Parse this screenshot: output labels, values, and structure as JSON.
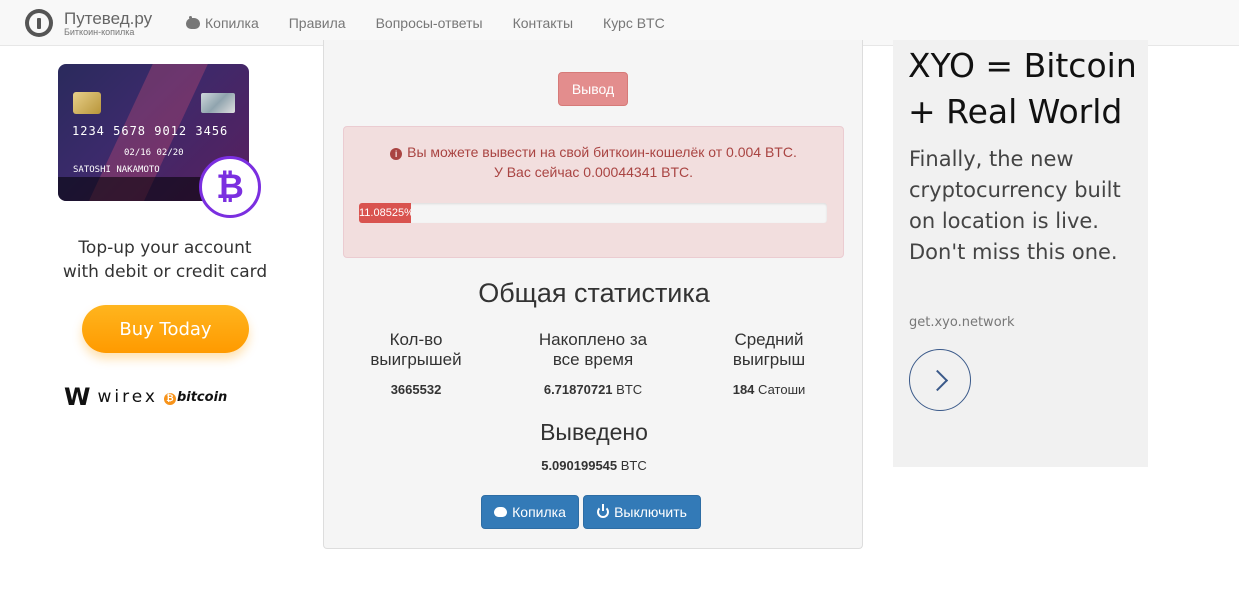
{
  "brand": {
    "title": "Путевед.ру",
    "subtitle": "Биткоин-копилка"
  },
  "nav": {
    "items": [
      {
        "label": "Копилка",
        "icon": "piggy-bank-icon"
      },
      {
        "label": "Правила"
      },
      {
        "label": "Вопросы-ответы"
      },
      {
        "label": "Контакты"
      },
      {
        "label": "Курс BTC"
      }
    ]
  },
  "ad_left": {
    "card_number": "1234 5678 9012 3456",
    "card_dates": "02/16  02/20",
    "card_name": "SATOSHI NAKAMOTO",
    "text_line1": "Top-up your account",
    "text_line2": "with debit or credit card",
    "button_label": "Buy Today",
    "brand_word": "wirex",
    "brand_btc": "bitcoin"
  },
  "main": {
    "withdraw_button": "Вывод",
    "alert_line1": "Вы можете вывести на свой биткоин-кошелёк от 0.004 BTC.",
    "alert_line2": "У Вас сейчас 0.00044341 BTC.",
    "progress_label": "11.08525%",
    "progress_percent": 11.08525,
    "stats_title": "Общая статистика",
    "stats": [
      {
        "label_line1": "Кол-во",
        "label_line2": "выигрышей",
        "value": "3665532",
        "unit": ""
      },
      {
        "label_line1": "Накоплено за",
        "label_line2": "все время",
        "value": "6.71870721",
        "unit": "BTC"
      },
      {
        "label_line1": "Средний",
        "label_line2": "выигрыш",
        "value": "184",
        "unit": "Сатоши"
      }
    ],
    "withdrawn_title": "Выведено",
    "withdrawn_value": "5.090199545",
    "withdrawn_unit": "BTC",
    "buttons": {
      "kopilka": "Копилка",
      "disable": "Выключить"
    }
  },
  "ad_right": {
    "title_line1": "XYO = Bitcoin",
    "title_line2": "+ Real World",
    "description": "Finally, the new cryptocurrency built on location is live. Don't miss this one.",
    "url": "get.xyo.network"
  },
  "colors": {
    "navbar_bg": "#f8f8f8",
    "danger": "#d9534f",
    "alert_bg": "#f2dede",
    "primary": "#337ab7",
    "buy_button": "#ff9f00",
    "wirex_accent": "#7b2fe0"
  }
}
